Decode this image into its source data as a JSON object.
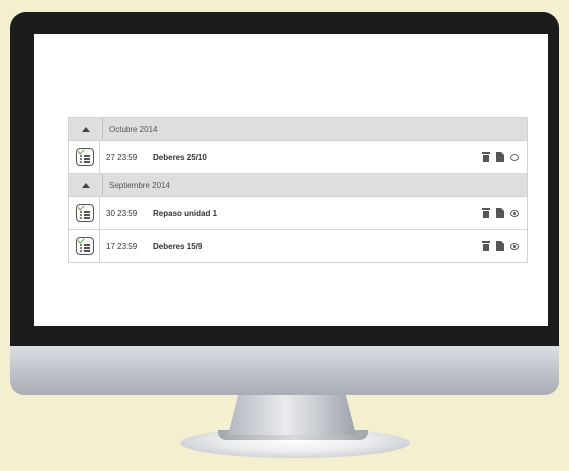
{
  "groups": [
    {
      "title": "Octubre 2014",
      "items": [
        {
          "date": "27 23:59",
          "title": "Deberes 25/10",
          "visible": false
        }
      ]
    },
    {
      "title": "Septiembre 2014",
      "items": [
        {
          "date": "30 23:59",
          "title": "Repaso unidad 1",
          "visible": true
        },
        {
          "date": "17 23:59",
          "title": "Deberes 15/9",
          "visible": true
        }
      ]
    }
  ],
  "icons": {
    "collapse": "triangle-up-icon",
    "task": "task-list-icon",
    "delete": "trash-icon",
    "edit": "edit-icon",
    "visibility_on": "eye-icon",
    "visibility_off": "eye-closed-icon"
  },
  "colors": {
    "background": "#f4efcf",
    "header": "#dedede",
    "check": "#5aa83c"
  }
}
